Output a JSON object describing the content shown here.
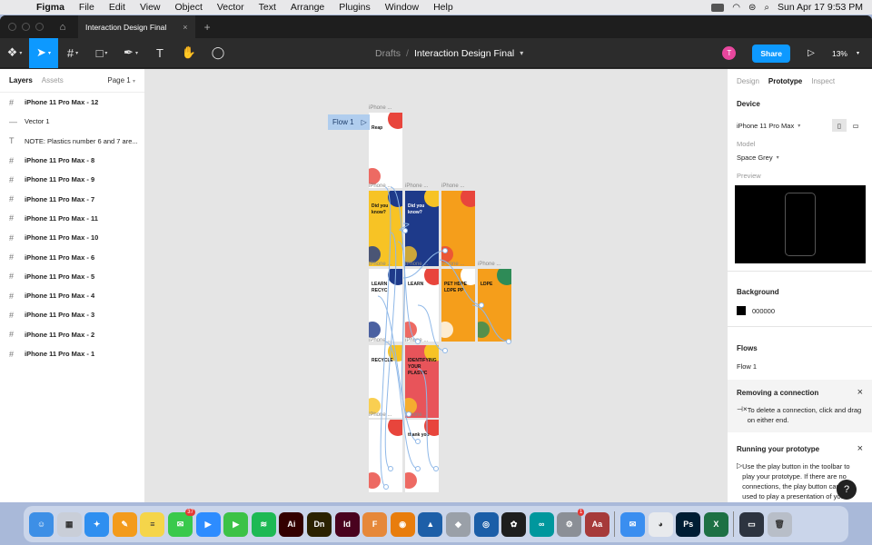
{
  "menubar": {
    "app": "Figma",
    "items": [
      "File",
      "Edit",
      "View",
      "Object",
      "Vector",
      "Text",
      "Arrange",
      "Plugins",
      "Window",
      "Help"
    ],
    "datetime": "Sun Apr 17  9:53 PM"
  },
  "tabbar": {
    "file_tab": "Interaction Design Final"
  },
  "toolbar": {
    "breadcrumb_root": "Drafts",
    "breadcrumb_sep": "/",
    "file_name": "Interaction Design Final",
    "avatar_initial": "T",
    "share_label": "Share",
    "zoom": "13%"
  },
  "left_panel": {
    "tab_layers": "Layers",
    "tab_assets": "Assets",
    "page": "Page 1",
    "layers": [
      {
        "icon": "frame-icon",
        "glyph": "#",
        "name": "iPhone 11 Pro Max - 12",
        "bold": true
      },
      {
        "icon": "vector-icon",
        "glyph": "—",
        "name": "Vector 1",
        "bold": false
      },
      {
        "icon": "text-icon",
        "glyph": "T",
        "name": "NOTE: Plastics number 6 and 7 are...",
        "bold": false
      },
      {
        "icon": "frame-icon",
        "glyph": "#",
        "name": "iPhone 11 Pro Max - 8",
        "bold": true
      },
      {
        "icon": "frame-icon",
        "glyph": "#",
        "name": "iPhone 11 Pro Max - 9",
        "bold": true
      },
      {
        "icon": "frame-icon",
        "glyph": "#",
        "name": "iPhone 11 Pro Max - 7",
        "bold": true
      },
      {
        "icon": "frame-icon",
        "glyph": "#",
        "name": "iPhone 11 Pro Max - 11",
        "bold": true
      },
      {
        "icon": "frame-icon",
        "glyph": "#",
        "name": "iPhone 11 Pro Max - 10",
        "bold": true
      },
      {
        "icon": "frame-icon",
        "glyph": "#",
        "name": "iPhone 11 Pro Max - 6",
        "bold": true
      },
      {
        "icon": "frame-icon",
        "glyph": "#",
        "name": "iPhone 11 Pro Max - 5",
        "bold": true
      },
      {
        "icon": "frame-icon",
        "glyph": "#",
        "name": "iPhone 11 Pro Max - 4",
        "bold": true
      },
      {
        "icon": "frame-icon",
        "glyph": "#",
        "name": "iPhone 11 Pro Max - 3",
        "bold": true
      },
      {
        "icon": "frame-icon",
        "glyph": "#",
        "name": "iPhone 11 Pro Max - 2",
        "bold": true
      },
      {
        "icon": "frame-icon",
        "glyph": "#",
        "name": "iPhone 11 Pro Max - 1",
        "bold": true
      }
    ]
  },
  "canvas": {
    "flow_label": "Flow 1",
    "frame_label": "iPhone ...",
    "frames": [
      {
        "label": "iPhone ...",
        "text": "Reap",
        "bg": "#ffffff",
        "accent": "#e8453c"
      },
      {
        "label": "iPhone ...",
        "text": "Did you know?",
        "bg": "#f7c325",
        "accent": "#1e3a8a"
      },
      {
        "label": "iPhone ...",
        "text": "Did you know?",
        "bg": "#1e3a8a",
        "accent": "#f7c325"
      },
      {
        "label": "iPhone ...",
        "text": "",
        "bg": "#f59e1b",
        "accent": "#e8453c"
      },
      {
        "label": "iPhone ...",
        "text": "LEARN RECYC",
        "bg": "#ffffff",
        "accent": "#1e3a8a"
      },
      {
        "label": "iPhone ...",
        "text": "LEARN",
        "bg": "#ffffff",
        "accent": "#e8453c"
      },
      {
        "label": "iPhone ...",
        "text": "PET HDPE LDPE PP",
        "bg": "#f59e1b",
        "accent": "#ffffff"
      },
      {
        "label": "iPhone ...",
        "text": "LDPE",
        "bg": "#f59e1b",
        "accent": "#2e8b57"
      },
      {
        "label": "iPhone ...",
        "text": "RECYCLE",
        "bg": "#ffffff",
        "accent": "#f7c325"
      },
      {
        "label": "iPhone ...",
        "text": "IDENTIFYING YOUR PLASTIC",
        "bg": "#e8545a",
        "accent": "#f7c325"
      },
      {
        "label": "iPhone ...",
        "text": "",
        "bg": "#ffffff",
        "accent": "#e8453c"
      },
      {
        "label": "iPhone ...",
        "text": "thank you",
        "bg": "#ffffff",
        "accent": "#e8453c"
      }
    ]
  },
  "right_panel": {
    "tab_design": "Design",
    "tab_prototype": "Prototype",
    "tab_inspect": "Inspect",
    "device_heading": "Device",
    "device_value": "iPhone 11 Pro Max",
    "model_label": "Model",
    "model_value": "Space Grey",
    "preview_label": "Preview",
    "background_heading": "Background",
    "background_value": "000000",
    "flows_heading": "Flows",
    "flow_item": "Flow 1",
    "tip1_title": "Removing a connection",
    "tip1_text": "To delete a connection, click and drag on either end.",
    "tip2_title": "Running your prototype",
    "tip2_text": "Use the play button in the toolbar to play your prototype. If there are no connections, the play button can be used to play a presentation of your frames.",
    "help": "?"
  },
  "dock": {
    "apps": [
      {
        "name": "finder",
        "bg": "#3d8fe6",
        "glyph": "☺"
      },
      {
        "name": "launchpad",
        "bg": "#c9ced8",
        "glyph": "▦"
      },
      {
        "name": "safari",
        "bg": "#2f8ff0",
        "glyph": "✦"
      },
      {
        "name": "pages",
        "bg": "#f39b1c",
        "glyph": "✎"
      },
      {
        "name": "notes",
        "bg": "#f5d54a",
        "glyph": "≡"
      },
      {
        "name": "messages",
        "bg": "#39c94c",
        "glyph": "✉",
        "badge": "37"
      },
      {
        "name": "zoom",
        "bg": "#2d8cff",
        "glyph": "▶"
      },
      {
        "name": "facetime",
        "bg": "#3cc247",
        "glyph": "▶"
      },
      {
        "name": "spotify",
        "bg": "#1db954",
        "glyph": "≋"
      },
      {
        "name": "illustrator",
        "bg": "#330000",
        "glyph": "Ai"
      },
      {
        "name": "dimension",
        "bg": "#2b2200",
        "glyph": "Dn"
      },
      {
        "name": "indesign",
        "bg": "#49021f",
        "glyph": "Id"
      },
      {
        "name": "fontbook",
        "bg": "#e6883a",
        "glyph": "F"
      },
      {
        "name": "blender",
        "bg": "#e87d0d",
        "glyph": "◉"
      },
      {
        "name": "sketchup",
        "bg": "#1d5fa8",
        "glyph": "▲"
      },
      {
        "name": "rhino",
        "bg": "#9aa0a8",
        "glyph": "◆"
      },
      {
        "name": "aperture",
        "bg": "#1b5ea8",
        "glyph": "◎"
      },
      {
        "name": "figma",
        "bg": "#1e1e1e",
        "glyph": "✿"
      },
      {
        "name": "arduino",
        "bg": "#00979d",
        "glyph": "∞"
      },
      {
        "name": "system-preferences",
        "bg": "#8b8f96",
        "glyph": "⚙",
        "badge": "1"
      },
      {
        "name": "dictionary",
        "bg": "#a63a3a",
        "glyph": "Aa"
      },
      {
        "name": "mail",
        "bg": "#3a8ef0",
        "glyph": "✉"
      },
      {
        "name": "chrome",
        "bg": "#e8eaed",
        "glyph": "◕"
      },
      {
        "name": "photoshop",
        "bg": "#001d34",
        "glyph": "Ps"
      },
      {
        "name": "excel",
        "bg": "#1d7044",
        "glyph": "X"
      },
      {
        "name": "screen",
        "bg": "#2d3440",
        "glyph": "▭"
      },
      {
        "name": "trash",
        "bg": "#b8bec8",
        "glyph": "🗑"
      }
    ]
  }
}
